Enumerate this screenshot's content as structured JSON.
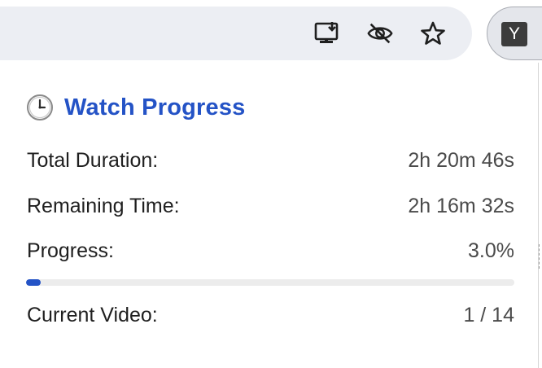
{
  "toolbar": {
    "icons": [
      "install-app-icon",
      "eye-off-icon",
      "bookmark-star-icon"
    ],
    "extension_letter": "Y"
  },
  "popup": {
    "title": "Watch Progress",
    "title_icon": "clock-icon",
    "accent_color": "#2453c6",
    "rows": [
      {
        "label": "Total Duration:",
        "value": "2h 20m 46s"
      },
      {
        "label": "Remaining Time:",
        "value": "2h 16m 32s"
      },
      {
        "label": "Progress:",
        "value": "3.0%"
      },
      {
        "label": "Current Video:",
        "value": "1 / 14"
      }
    ],
    "progress_percent": 3.0
  }
}
